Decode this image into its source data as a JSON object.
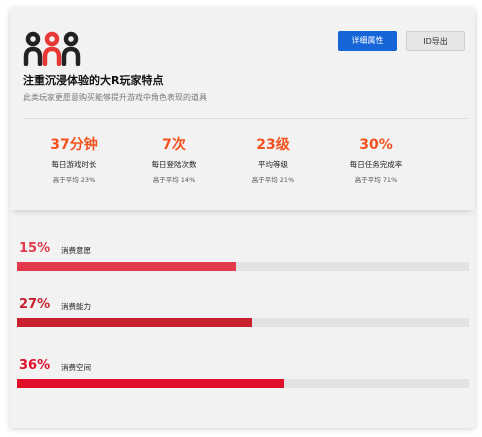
{
  "header": {
    "title": "注重沉浸体验的大R玩家特点",
    "subtitle": "此类玩家更愿意购买能够提升游戏中角色表现的道具",
    "buttons": {
      "details": "详细属性",
      "export": "ID导出"
    }
  },
  "colors": {
    "accent": "#f4511e",
    "primary_button": "#1565d8",
    "logo_dark": "#222222",
    "logo_red": "#e53935"
  },
  "icons": {
    "logo": "group-people-icon"
  },
  "stats": [
    {
      "value": "37分钟",
      "label": "每日游戏时长",
      "sub": "高于平均 23%"
    },
    {
      "value": "7次",
      "label": "每日登陆次数",
      "sub": "高于平均 14%"
    },
    {
      "value": "23级",
      "label": "平均等级",
      "sub": "高于平均 21%"
    },
    {
      "value": "30%",
      "label": "每日任务完成率",
      "sub": "高于平均 71%"
    }
  ],
  "bars": [
    {
      "percent_text": "15%",
      "label": "消费意愿",
      "fill_fraction": 0.485,
      "color": "#e23a4a"
    },
    {
      "percent_text": "27%",
      "label": "消费能力",
      "fill_fraction": 0.52,
      "color": "#c8202e"
    },
    {
      "percent_text": "36%",
      "label": "消费空间",
      "fill_fraction": 0.59,
      "color": "#e0102a"
    }
  ]
}
